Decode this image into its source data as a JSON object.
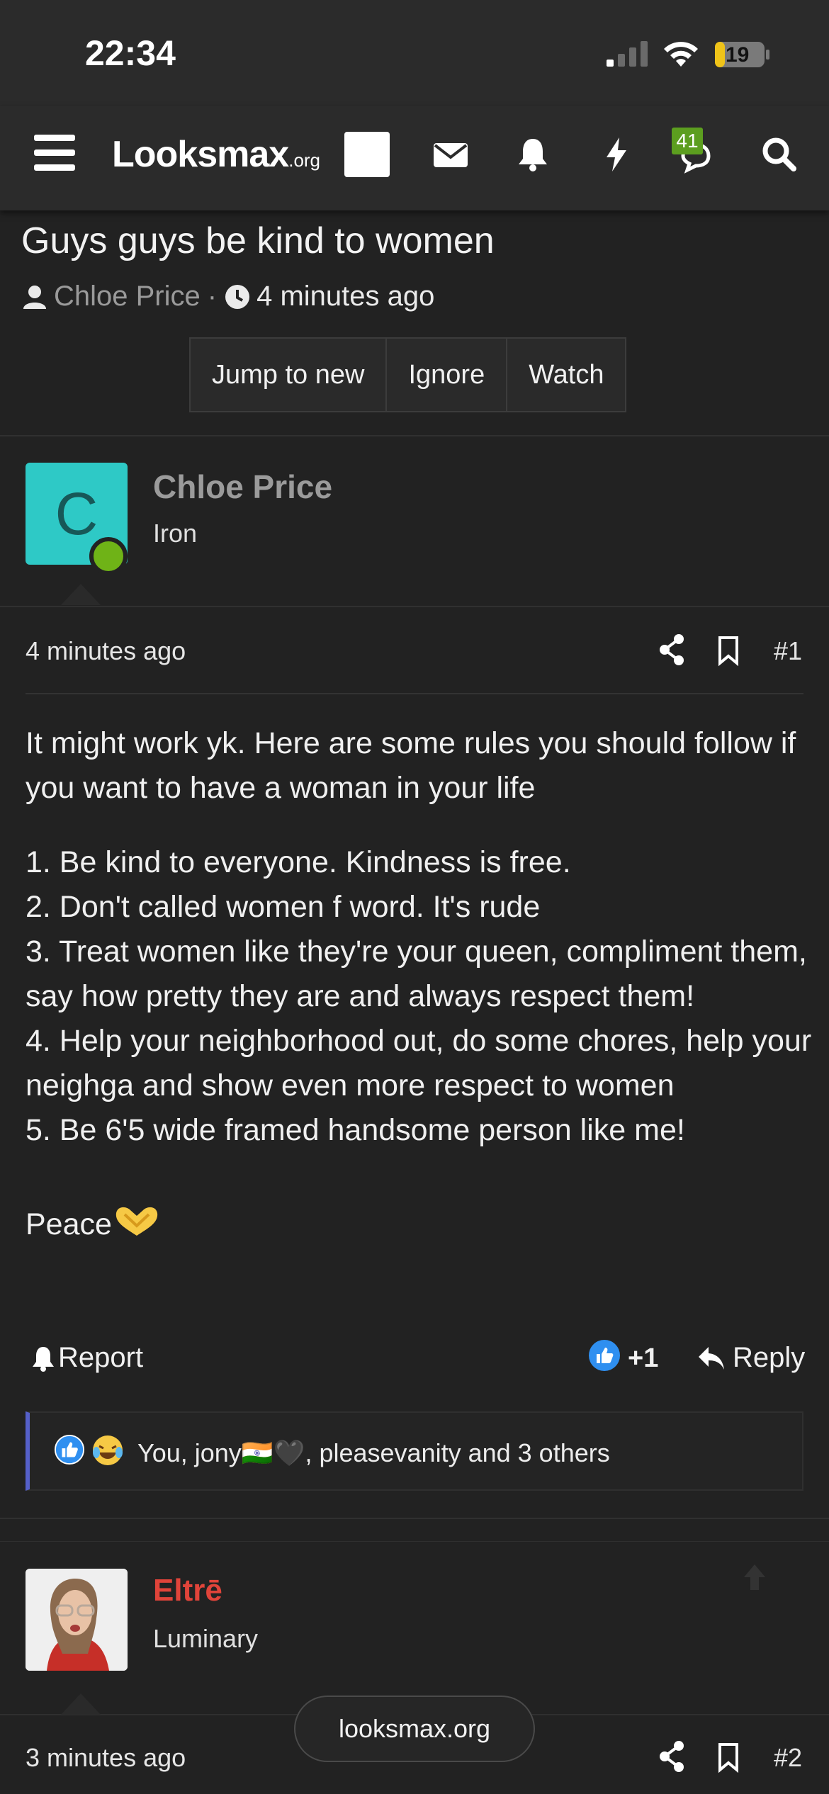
{
  "status_bar": {
    "time": "22:34",
    "battery": "19"
  },
  "header": {
    "logo_main": "Looksmax",
    "logo_suffix": ".org",
    "chat_badge": "41",
    "icons": [
      "menu-icon",
      "envelope-icon",
      "bell-icon",
      "bolt-icon",
      "chat-icon",
      "search-icon"
    ]
  },
  "thread": {
    "title": "Guys guys be kind to women",
    "author": "Chloe Price",
    "separator": "·",
    "time": "4 minutes ago",
    "buttons": {
      "jump": "Jump to new",
      "ignore": "Ignore",
      "watch": "Watch"
    }
  },
  "post1": {
    "avatar_letter": "C",
    "username": "Chloe Price",
    "user_title": "Iron",
    "date": "4 minutes ago",
    "number": "#1",
    "lines": {
      "l1": "It might work yk. Here are some rules you should follow if you want to have a woman in your life",
      "l2": "1. Be kind to everyone. Kindness is free.",
      "l3": "2. Don't called women f word. It's rude",
      "l4": "3. Treat women like they're your queen, compliment them, say how pretty they are and always respect them!",
      "l5": "4. Help your neighborhood out, do some chores, help your neighga and show even more respect to women",
      "l6": "5. Be 6'5 wide framed handsome person like me!",
      "l7": "Peace"
    },
    "report_label": "Report",
    "like_count": "+1",
    "reply_label": "Reply",
    "reactions_text": "You, jony🇮🇳🖤, pleasevanity and 3 others"
  },
  "post2": {
    "username": "Eltrē",
    "user_title": "Luminary",
    "date": "3 minutes ago",
    "number": "#2"
  },
  "url_pill": "looksmax.org",
  "colors": {
    "accent_blue": "#5560c9",
    "username_red": "#e0443a",
    "badge_green": "#5c9e1f",
    "avatar_teal": "#2ec9c6"
  }
}
